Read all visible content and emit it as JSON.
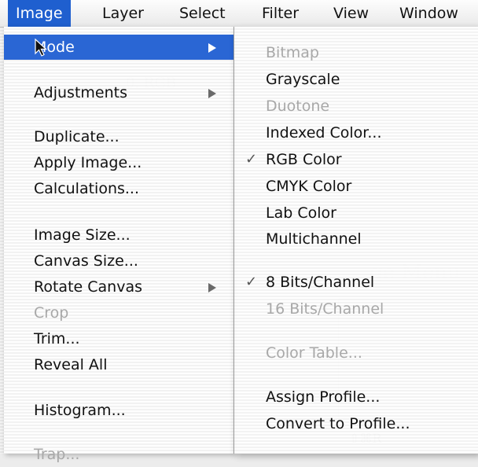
{
  "menubar": {
    "items": [
      "Image",
      "Layer",
      "Select",
      "Filter",
      "View",
      "Window"
    ]
  },
  "image_menu": {
    "items": [
      {
        "label": "Mode",
        "submenu": true,
        "highlighted": true,
        "enabled": true
      },
      {
        "label": "Adjustments",
        "submenu": true,
        "enabled": true
      },
      {
        "label": "Duplicate...",
        "enabled": true
      },
      {
        "label": "Apply Image...",
        "enabled": true
      },
      {
        "label": "Calculations...",
        "enabled": true
      },
      {
        "label": "Image Size...",
        "enabled": true
      },
      {
        "label": "Canvas Size...",
        "enabled": true
      },
      {
        "label": "Rotate Canvas",
        "submenu": true,
        "enabled": true
      },
      {
        "label": "Crop",
        "enabled": false
      },
      {
        "label": "Trim...",
        "enabled": true
      },
      {
        "label": "Reveal All",
        "enabled": true
      },
      {
        "label": "Histogram...",
        "enabled": true
      },
      {
        "label": "Trap...",
        "enabled": false
      }
    ]
  },
  "mode_submenu": {
    "items": [
      {
        "label": "Bitmap",
        "enabled": false
      },
      {
        "label": "Grayscale",
        "enabled": true
      },
      {
        "label": "Duotone",
        "enabled": false
      },
      {
        "label": "Indexed Color...",
        "enabled": true
      },
      {
        "label": "RGB Color",
        "enabled": true,
        "checked": true
      },
      {
        "label": "CMYK Color",
        "enabled": true
      },
      {
        "label": "Lab Color",
        "enabled": true
      },
      {
        "label": "Multichannel",
        "enabled": true
      },
      {
        "label": "8 Bits/Channel",
        "enabled": true,
        "checked": true
      },
      {
        "label": "16 Bits/Channel",
        "enabled": false
      },
      {
        "label": "Color Table...",
        "enabled": false
      },
      {
        "label": "Assign Profile...",
        "enabled": true
      },
      {
        "label": "Convert to Profile...",
        "enabled": true
      }
    ],
    "check_glyph": "✓"
  }
}
